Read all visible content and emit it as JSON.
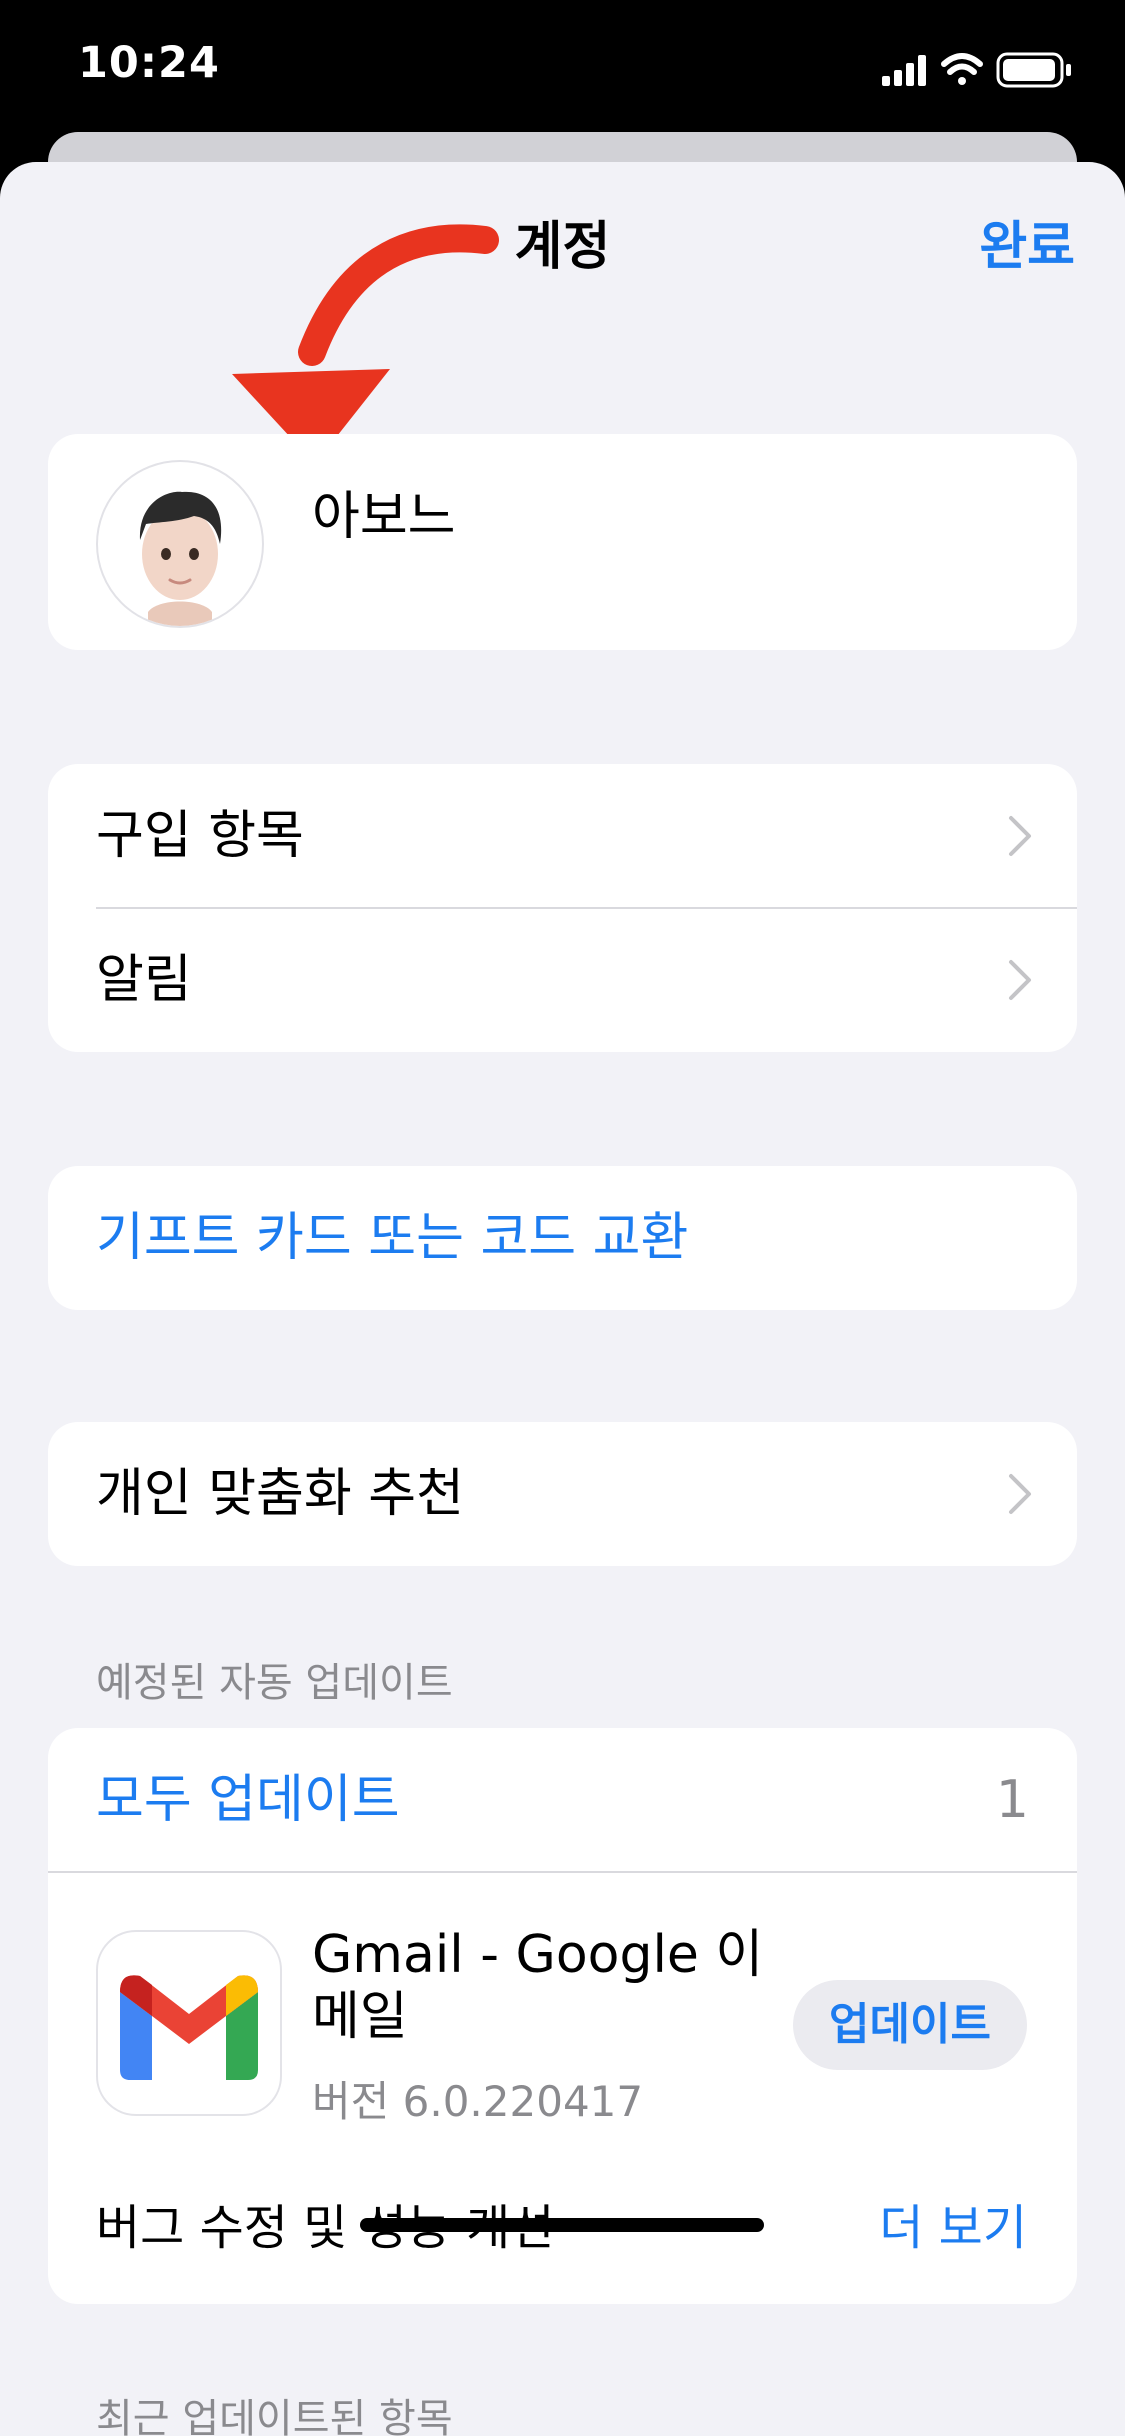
{
  "status_bar": {
    "time": "10:24"
  },
  "nav": {
    "title": "계정",
    "done": "완료"
  },
  "profile": {
    "name": "아보느"
  },
  "list1": [
    {
      "label": "구입 항목"
    },
    {
      "label": "알림"
    }
  ],
  "gift": {
    "label": "기프트 카드 또는 코드 교환"
  },
  "personal": {
    "label": "개인 맞춤화 추천"
  },
  "updates": {
    "header": "예정된 자동 업데이트",
    "update_all": "모두 업데이트",
    "count": "1",
    "app": {
      "name": "Gmail - Google 이메일",
      "version": "버전 6.0.220417",
      "button": "업데이트",
      "notes": "버그 수정 및 성능 개선",
      "more": "더 보기"
    }
  },
  "recent_header": "최근 업데이트된 항목",
  "colors": {
    "accent": "#1c7cf0",
    "background": "#f2f2f7",
    "annotation": "#e8341f"
  },
  "icons": [
    "cellular-signal-icon",
    "wifi-icon",
    "battery-icon",
    "chevron-right-icon",
    "gmail-icon",
    "memoji-avatar"
  ]
}
